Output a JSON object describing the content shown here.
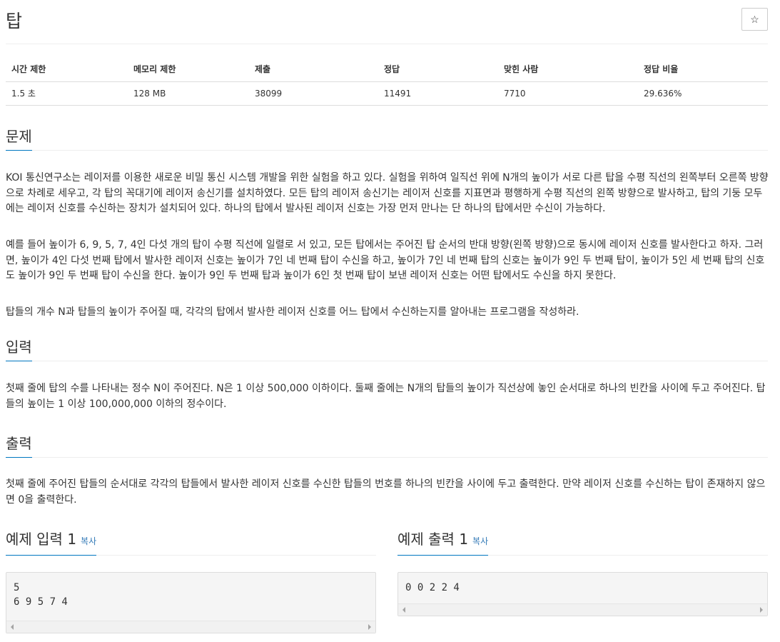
{
  "problem": {
    "title": "탑",
    "star_icon": "☆"
  },
  "info_table": {
    "headers": [
      "시간 제한",
      "메모리 제한",
      "제출",
      "정답",
      "맞힌 사람",
      "정답 비율"
    ],
    "values": [
      "1.5 초",
      "128 MB",
      "38099",
      "11491",
      "7710",
      "29.636%"
    ]
  },
  "sections": {
    "problem": {
      "title": "문제",
      "paragraphs": [
        "KOI 통신연구소는 레이저를 이용한 새로운 비밀 통신 시스템 개발을 위한 실험을 하고 있다. 실험을 위하여 일직선 위에 N개의 높이가 서로 다른 탑을 수평 직선의 왼쪽부터 오른쪽 방향으로 차례로 세우고, 각 탑의 꼭대기에 레이저 송신기를 설치하였다. 모든 탑의 레이저 송신기는 레이저 신호를 지표면과 평행하게 수평 직선의 왼쪽 방향으로 발사하고, 탑의 기둥 모두에는 레이저 신호를 수신하는 장치가 설치되어 있다. 하나의 탑에서 발사된 레이저 신호는 가장 먼저 만나는 단 하나의 탑에서만 수신이 가능하다.",
        "예를 들어 높이가 6, 9, 5, 7, 4인 다섯 개의 탑이 수평 직선에 일렬로 서 있고, 모든 탑에서는 주어진 탑 순서의 반대 방향(왼쪽 방향)으로 동시에 레이저 신호를 발사한다고 하자. 그러면, 높이가 4인 다섯 번째 탑에서 발사한 레이저 신호는 높이가 7인 네 번째 탑이 수신을 하고, 높이가 7인 네 번째 탑의 신호는 높이가 9인 두 번째 탑이, 높이가 5인 세 번째 탑의 신호도 높이가 9인 두 번째 탑이 수신을 한다. 높이가 9인 두 번째 탑과 높이가 6인 첫 번째 탑이 보낸 레이저 신호는 어떤 탑에서도 수신을 하지 못한다.",
        "탑들의 개수 N과 탑들의 높이가 주어질 때, 각각의 탑에서 발사한 레이저 신호를 어느 탑에서 수신하는지를 알아내는 프로그램을 작성하라."
      ]
    },
    "input": {
      "title": "입력",
      "text": "첫째 줄에 탑의 수를 나타내는 정수 N이 주어진다. N은 1 이상 500,000 이하이다. 둘째 줄에는 N개의 탑들의 높이가 직선상에 놓인 순서대로 하나의 빈칸을 사이에 두고 주어진다. 탑들의 높이는 1 이상 100,000,000 이하의 정수이다."
    },
    "output": {
      "title": "출력",
      "text": "첫째 줄에 주어진 탑들의 순서대로 각각의 탑들에서 발사한 레이저 신호를 수신한 탑들의 번호를 하나의 빈칸을 사이에 두고 출력한다. 만약 레이저 신호를 수신하는 탑이 존재하지 않으면 0을 출력한다."
    }
  },
  "samples": {
    "input": {
      "title": "예제 입력 1",
      "copy_label": "복사",
      "content": "5\n6 9 5 7 4"
    },
    "output": {
      "title": "예제 출력 1",
      "copy_label": "복사",
      "content": "0 0 2 2 4"
    }
  }
}
